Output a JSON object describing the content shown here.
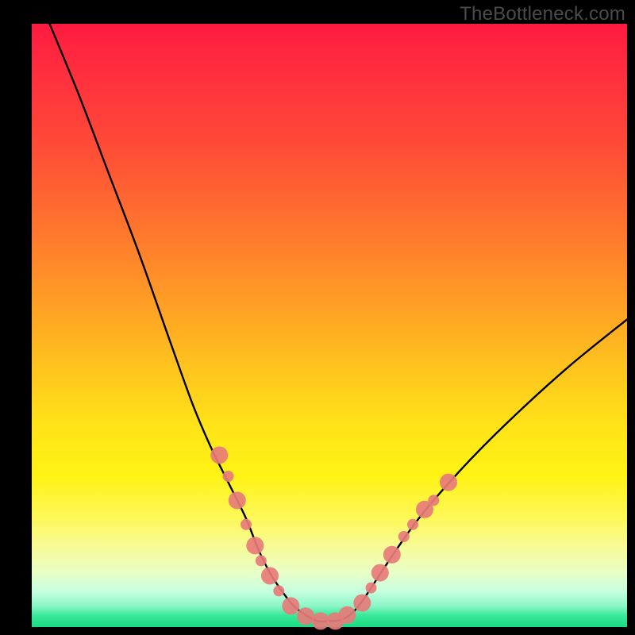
{
  "watermark": "TheBottleneck.com",
  "chart_data": {
    "type": "line",
    "title": "",
    "xlabel": "",
    "ylabel": "",
    "xlim": [
      0,
      100
    ],
    "ylim": [
      0,
      100
    ],
    "grid": false,
    "legend": false,
    "series": [
      {
        "name": "bottleneck-curve",
        "color": "#000000",
        "x": [
          3,
          8,
          13,
          18,
          23,
          27,
          30,
          33,
          36,
          38,
          40,
          42,
          44,
          46,
          48,
          50,
          52,
          54,
          56,
          60,
          65,
          72,
          80,
          90,
          100
        ],
        "y": [
          100,
          88,
          75,
          62,
          48,
          37,
          30,
          24,
          18,
          13,
          9,
          6,
          3.5,
          2,
          1,
          1,
          1.2,
          2.5,
          5,
          11,
          18,
          26,
          34,
          43,
          51
        ]
      }
    ],
    "markers": {
      "name": "highlighted-points",
      "color": "#e77b79",
      "radius_major": 11,
      "radius_minor": 7,
      "points": [
        {
          "x": 31.5,
          "y": 28.5,
          "r": "major"
        },
        {
          "x": 33.0,
          "y": 25.0,
          "r": "minor"
        },
        {
          "x": 34.5,
          "y": 21.0,
          "r": "major"
        },
        {
          "x": 36.0,
          "y": 17.0,
          "r": "minor"
        },
        {
          "x": 37.5,
          "y": 13.5,
          "r": "major"
        },
        {
          "x": 38.5,
          "y": 11.0,
          "r": "minor"
        },
        {
          "x": 40.0,
          "y": 8.5,
          "r": "major"
        },
        {
          "x": 41.5,
          "y": 6.0,
          "r": "minor"
        },
        {
          "x": 43.5,
          "y": 3.5,
          "r": "major"
        },
        {
          "x": 46.0,
          "y": 1.8,
          "r": "major"
        },
        {
          "x": 48.5,
          "y": 1.0,
          "r": "major"
        },
        {
          "x": 51.0,
          "y": 1.0,
          "r": "major"
        },
        {
          "x": 53.0,
          "y": 2.0,
          "r": "major"
        },
        {
          "x": 55.5,
          "y": 4.0,
          "r": "major"
        },
        {
          "x": 57.0,
          "y": 6.5,
          "r": "minor"
        },
        {
          "x": 58.5,
          "y": 9.0,
          "r": "major"
        },
        {
          "x": 60.5,
          "y": 12.0,
          "r": "major"
        },
        {
          "x": 62.5,
          "y": 15.0,
          "r": "minor"
        },
        {
          "x": 64.0,
          "y": 17.0,
          "r": "minor"
        },
        {
          "x": 66.0,
          "y": 19.5,
          "r": "major"
        },
        {
          "x": 67.5,
          "y": 21.0,
          "r": "minor"
        },
        {
          "x": 70.0,
          "y": 24.0,
          "r": "major"
        }
      ]
    }
  }
}
